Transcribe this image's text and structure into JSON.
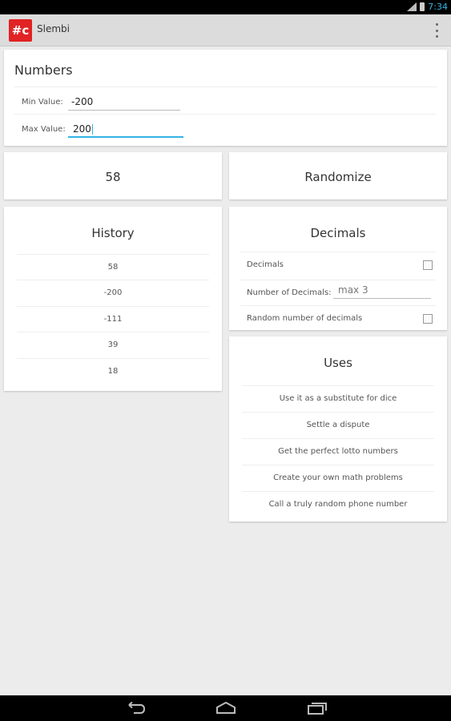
{
  "status_bar": {
    "time": "7:34"
  },
  "app": {
    "logo_text": "#c",
    "title": "Slembi"
  },
  "numbers": {
    "title": "Numbers",
    "min_label": "Min Value:",
    "min_value": "-200",
    "max_label": "Max Value:",
    "max_value": "200"
  },
  "result": {
    "value": "58"
  },
  "randomize": {
    "label": "Randomize"
  },
  "history": {
    "title": "History",
    "items": [
      "58",
      "-200",
      "-111",
      "39",
      "18"
    ]
  },
  "decimals": {
    "title": "Decimals",
    "decimals_label": "Decimals",
    "decimals_checked": false,
    "number_label": "Number of Decimals:",
    "number_placeholder": "max 3",
    "random_label": "Random number of decimals",
    "random_checked": false
  },
  "uses": {
    "title": "Uses",
    "items": [
      "Use it as a substitute for dice",
      "Settle a dispute",
      "Get the perfect lotto numbers",
      "Create your own math problems",
      "Call a truly random phone number"
    ]
  },
  "colors": {
    "accent": "#33b5e5",
    "brand": "#e12323"
  }
}
